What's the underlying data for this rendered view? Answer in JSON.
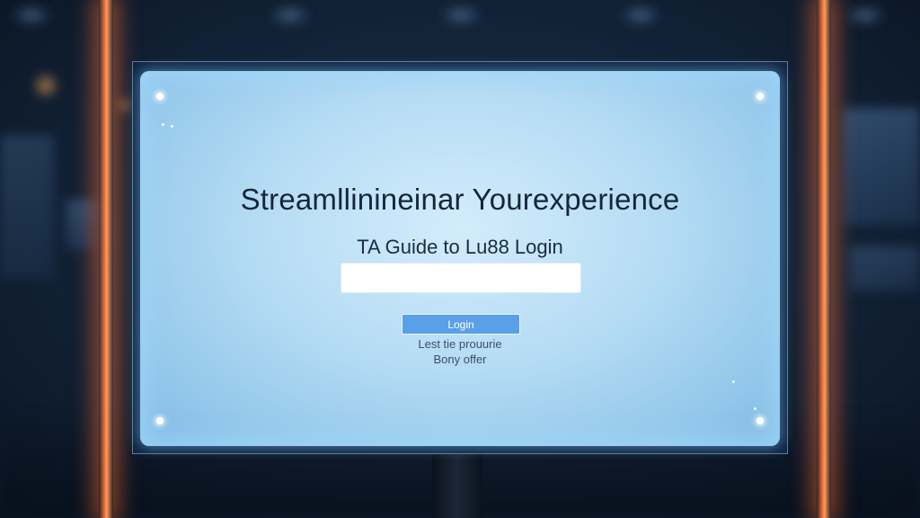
{
  "screen": {
    "headline": "Streamllinineinar Yourexperience",
    "subheadline": "TA Guide to Lu88 Login",
    "login_input_value": "",
    "login_button_label": "Login",
    "link_1": "Lest tie prouurie",
    "link_2": "Bony offer"
  },
  "colors": {
    "screen_glow": "#b5dcf4",
    "button": "#5aa0e8",
    "accent_beams": "#ff7a3c",
    "frame": "#0f2440"
  }
}
